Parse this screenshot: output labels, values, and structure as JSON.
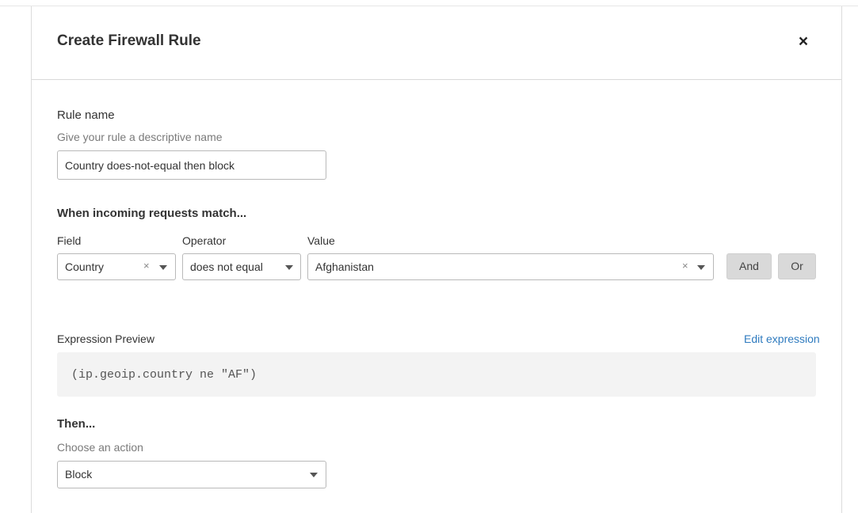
{
  "dialog": {
    "title": "Create Firewall Rule",
    "close_label": "×"
  },
  "rule_name": {
    "label": "Rule name",
    "hint": "Give your rule a descriptive name",
    "value": "Country does-not-equal then block"
  },
  "match": {
    "title": "When incoming requests match...",
    "field_label": "Field",
    "operator_label": "Operator",
    "value_label": "Value",
    "field_value": "Country",
    "operator_value": "does not equal",
    "value_value": "Afghanistan",
    "clear_glyph": "×",
    "and_label": "And",
    "or_label": "Or"
  },
  "expression": {
    "label": "Expression Preview",
    "edit_link": "Edit expression",
    "code": "(ip.geoip.country ne \"AF\")"
  },
  "then": {
    "title": "Then...",
    "hint": "Choose an action",
    "action_value": "Block"
  }
}
